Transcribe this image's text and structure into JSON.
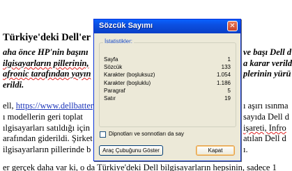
{
  "document": {
    "title": "Türkiye'deki Dell'er",
    "bold_lines": [
      "aha önce HP'nin başını",
      "ilgisayarların pillerinin,",
      "afronic tarafından yayın",
      "erildi."
    ],
    "bold_right_lines": [
      "ve başı Dell d",
      "a karar verildi",
      "plerinin yürü"
    ],
    "link_prefix": "ell, ",
    "link": "https://www.dellbattery",
    "link_suffix": "ı aşırı ısınma",
    "body_lines": [
      "ı modellerin geri toplat",
      "ılgisayarları satıldığı için",
      "arafından giderildi. Şirket",
      "ilgisayarların pillerinde b"
    ],
    "body_right_lines": [
      "sayıda Dell d",
      "işareti, Infro",
      "atılan Dell d",
      "ı."
    ],
    "bottom_line": "er gerçek daha var ki, o da Türkiye'deki Dell bilgisayarların hepsinin, sadece 1"
  },
  "dialog": {
    "title": "Sözcük Sayımı",
    "close_glyph": "✕",
    "group_label": "İstatistikler:",
    "stats": [
      {
        "label": "Sayfa",
        "value": "1"
      },
      {
        "label": "Sözcük",
        "value": "133"
      },
      {
        "label": "Karakter (boşluksuz)",
        "value": "1.054"
      },
      {
        "label": "Karakter (boşluklu)",
        "value": "1.186"
      },
      {
        "label": "Paragraf",
        "value": "5"
      },
      {
        "label": "Satır",
        "value": "19"
      }
    ],
    "checkbox_label": "Dipnotları ve sonnotları da say",
    "toolbar_button": "Araç Çubuğunu Göster",
    "close_button": "Kapat"
  }
}
